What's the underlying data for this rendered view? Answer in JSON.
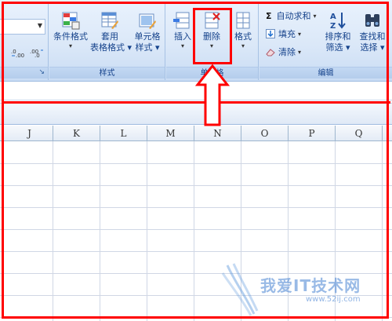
{
  "ribbon": {
    "styles_group": {
      "label": "样式",
      "conditional_format": "条件格式",
      "table_format_line1": "套用",
      "table_format_line2": "表格格式",
      "cell_styles_line1": "单元格",
      "cell_styles_line2": "样式"
    },
    "cells_group": {
      "label": "单元格",
      "insert": "插入",
      "delete": "删除",
      "format": "格式"
    },
    "editing_group": {
      "label": "编辑",
      "autosum": "自动求和",
      "fill": "填充",
      "clear": "清除",
      "sort_line1": "排序和",
      "sort_line2": "筛选",
      "find_line1": "查找和",
      "find_line2": "选择"
    },
    "number_group": {
      "increase_decimal": ".0 .00",
      "decrease_decimal": ".00 .0"
    }
  },
  "grid": {
    "columns": [
      "J",
      "K",
      "L",
      "M",
      "N",
      "O",
      "P",
      "Q"
    ]
  },
  "watermark": {
    "text": "我爱IT技术网",
    "url": "www.52ij.com"
  },
  "colors": {
    "annotation": "#ff0000",
    "ribbon_text": "#15428b",
    "gridline": "#d0d7e5"
  }
}
